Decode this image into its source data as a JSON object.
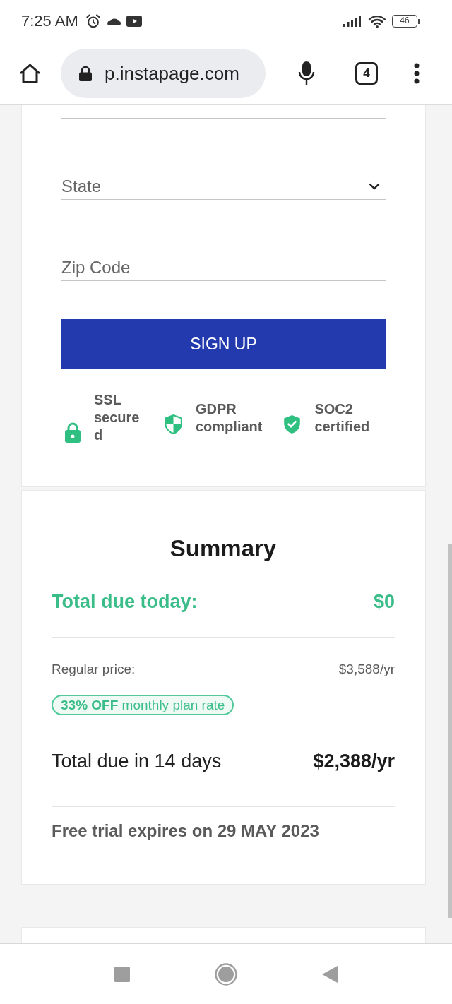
{
  "status_bar": {
    "time": "7:25 AM",
    "battery": "46"
  },
  "browser_bar": {
    "url": "p.instapage.com",
    "tab_count": "4"
  },
  "signup_form": {
    "fields": [
      {
        "kind": "input"
      },
      {
        "kind": "select",
        "placeholder": "State"
      },
      {
        "kind": "input",
        "placeholder": "Zip Code"
      }
    ],
    "submit_button": "SIGN UP",
    "trust_badges": [
      {
        "kind": "lock",
        "label": "SSL secured"
      },
      {
        "kind": "shield",
        "label": "GDPR compliant"
      },
      {
        "kind": "check",
        "label": "SOC2 certified"
      }
    ]
  },
  "summary": {
    "title": "Summary",
    "due_today": {
      "label": "Total due today:",
      "amount": "$0"
    },
    "regular_price": {
      "label": "Regular price:",
      "amount": "$3,588/yr"
    },
    "discount_tag": "**33% OFF** monthly plan rate",
    "due_later": {
      "label": "Total due in 14 days",
      "amount": "$2,388/yr"
    },
    "trial_note": "Free trial expires on 29 MAY 2023"
  }
}
